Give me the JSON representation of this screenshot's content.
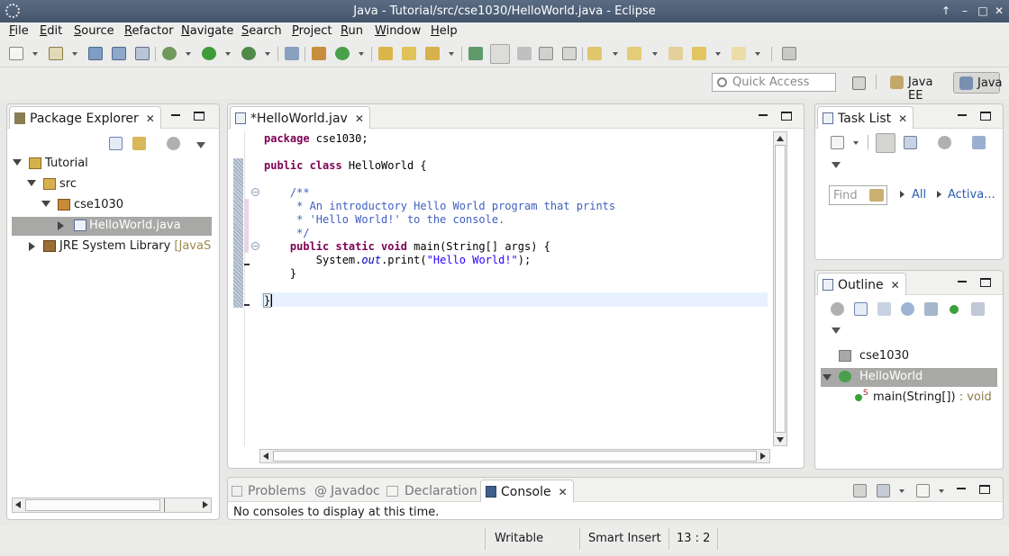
{
  "window": {
    "title": "Java - Tutorial/src/cse1030/HelloWorld.java - Eclipse",
    "controls": [
      "↑",
      "–",
      "□",
      "✕"
    ]
  },
  "menubar": {
    "items": [
      {
        "hotkey": "F",
        "rest": "ile"
      },
      {
        "hotkey": "E",
        "rest": "dit"
      },
      {
        "hotkey": "S",
        "rest": "ource"
      },
      {
        "hotkey": "R",
        "rest": "efactor",
        "label_full": "Refactor"
      },
      {
        "hotkey": "N",
        "rest": "avigate"
      },
      {
        "hotkey": "S",
        "rest": "earch"
      },
      {
        "hotkey": "P",
        "rest": "roject"
      },
      {
        "hotkey": "R",
        "rest": "un"
      },
      {
        "hotkey": "W",
        "rest": "indow"
      },
      {
        "hotkey": "H",
        "rest": "elp"
      }
    ]
  },
  "perspective": {
    "quick_access_placeholder": "Quick Access",
    "java_ee": "Java EE",
    "java": "Java"
  },
  "package_explorer": {
    "tab_label": "Package Explorer",
    "close": "✕",
    "tree": {
      "project": "Tutorial",
      "src": "src",
      "package": "cse1030",
      "file": "HelloWorld.java",
      "jre_label": "JRE System Library",
      "jre_decoration": "[JavaSE-"
    }
  },
  "editor": {
    "tab_label": "*HelloWorld.jav",
    "close": "✕",
    "code": {
      "l1_kw": "package",
      "l1_rest": " cse1030;",
      "l3_kw": "public class",
      "l3_rest": " HelloWorld {",
      "l5": "    /**",
      "l6": "     * An introductory Hello World program that prints",
      "l7": "     * 'Hello World!' to the console.",
      "l8": "     */",
      "l9_indent": "    ",
      "l9_kw": "public static void",
      "l9_rest": " main(String[] args) {",
      "l10_a": "        System.",
      "l10_field": "out",
      "l10_b": ".print(",
      "l10_str": "\"Hello World!\"",
      "l10_c": ");",
      "l11": "    }",
      "l13": "}"
    }
  },
  "task_list": {
    "tab_label": "Task List",
    "close": "✕",
    "find_placeholder": "Find",
    "all": "All",
    "activate": "Activa..."
  },
  "outline": {
    "tab_label": "Outline",
    "close": "✕",
    "package": "cse1030",
    "class": "HelloWorld",
    "method": "main(String[])",
    "method_type": " : void",
    "static_mark": "S"
  },
  "bottom_panel": {
    "tabs": [
      {
        "label": "Problems"
      },
      {
        "label": "Javadoc"
      },
      {
        "label": "Declaration"
      },
      {
        "label": "Console"
      }
    ],
    "close": "✕",
    "javadoc_icon": "@",
    "console_message": "No consoles to display at this time."
  },
  "statusbar": {
    "writable": "Writable",
    "insert_mode": "Smart Insert",
    "position": "13 : 2"
  },
  "colors": {
    "keyword": "#7f0055",
    "comment": "#3f5fbf",
    "string": "#2a00ff",
    "field": "#0000c0",
    "selection": "#a8a8a6"
  },
  "icons": {
    "eclipse": "eclipse-logo-icon",
    "class": "java-class-icon",
    "package": "package-icon",
    "project": "project-folder-icon"
  }
}
